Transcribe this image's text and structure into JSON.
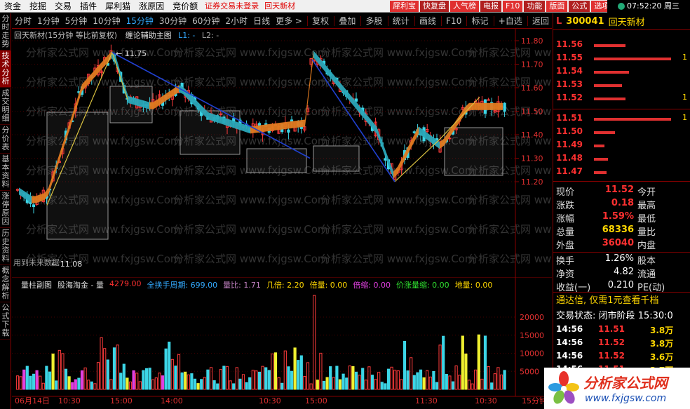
{
  "menu": {
    "items": [
      "资金",
      "挖掘",
      "交易",
      "插件",
      "犀利猫",
      "涨原因",
      "竞价额"
    ],
    "warn1": "证券交易未登录",
    "warn2": "回天新材",
    "right_buttons": [
      "犀利宝",
      "快复盘",
      "人气榜",
      "电报",
      "F10",
      "功能",
      "版面",
      "公式",
      "选项"
    ],
    "clock": "07:52:20 周三"
  },
  "left_tabs": [
    {
      "label": "分时走势",
      "active": false
    },
    {
      "label": "技术分析",
      "active": true
    },
    {
      "label": "成交明细",
      "active": false
    },
    {
      "label": "分价表",
      "active": false
    },
    {
      "label": "基本资料",
      "active": false
    },
    {
      "label": "涨停原因",
      "active": false
    },
    {
      "label": "历史资料",
      "active": false
    },
    {
      "label": "概念解析",
      "active": false
    },
    {
      "label": "公式下载",
      "active": false
    }
  ],
  "period_tabs": [
    {
      "label": "分时",
      "active": false
    },
    {
      "label": "1分钟",
      "active": false
    },
    {
      "label": "5分钟",
      "active": false
    },
    {
      "label": "10分钟",
      "active": false
    },
    {
      "label": "15分钟",
      "active": true
    },
    {
      "label": "30分钟",
      "active": false
    },
    {
      "label": "60分钟",
      "active": false
    },
    {
      "label": "2小时",
      "active": false
    },
    {
      "label": "日线",
      "active": false
    },
    {
      "label": "更多 >",
      "active": false
    }
  ],
  "tool_tabs": [
    "复权",
    "叠加",
    "多股",
    "统计",
    "画线",
    "F10",
    "标记",
    "+自选",
    "返回"
  ],
  "chart_title": {
    "name": "回天新材(15分钟 等比前复权)",
    "indicator": "缠论辅助主图",
    "l1": "L1: -",
    "l2": "L2: -"
  },
  "annotations": {
    "high_label": "11.75",
    "low_label": "11.08",
    "future_label": "用到未来数据"
  },
  "watermark": "分析家公式网 www.fxjgsw.Com",
  "price_axis": [
    "11.80",
    "11.70",
    "11.60",
    "11.50",
    "11.40",
    "11.30",
    "11.20"
  ],
  "vol_axis": [
    "20000",
    "15000",
    "10000",
    "5000"
  ],
  "time_axis": [
    "06月14日",
    "10:30",
    "15:00",
    "14:00",
    "10:30",
    "15:00",
    "11:30",
    "10:30",
    "15分钟"
  ],
  "vol_header": {
    "title": "量柱副图",
    "sub": "股海淘金 - 量",
    "vol": "4279.00",
    "cycle": "全换手周期: 699.00",
    "liangbi": "量比: 1.71",
    "jibei": "几倍: 2.20",
    "beiliang": "倍量: 0.00",
    "beisuo": "倍缩: 0.00",
    "jiazhang": "价涨量缩: 0.00",
    "diliang": "地量: 0.00"
  },
  "quote": {
    "market": "L",
    "code": "300041",
    "name": "回天新材",
    "asks": [
      {
        "price": "11.56",
        "vol": ""
      },
      {
        "price": "11.55",
        "vol": "1"
      },
      {
        "price": "11.54",
        "vol": ""
      },
      {
        "price": "11.53",
        "vol": ""
      },
      {
        "price": "11.52",
        "vol": "1"
      }
    ],
    "bids": [
      {
        "price": "11.51",
        "vol": "1"
      },
      {
        "price": "11.50",
        "vol": ""
      },
      {
        "price": "11.49",
        "vol": ""
      },
      {
        "price": "11.48",
        "vol": ""
      },
      {
        "price": "11.47",
        "vol": ""
      }
    ],
    "stats": [
      {
        "label": "现价",
        "value": "11.52",
        "label2": "今开",
        "color": "r"
      },
      {
        "label": "涨跌",
        "value": "0.18",
        "label2": "最高",
        "color": "r"
      },
      {
        "label": "涨幅",
        "value": "1.59%",
        "label2": "最低",
        "color": "r"
      },
      {
        "label": "总量",
        "value": "68336",
        "label2": "量比",
        "color": "y"
      },
      {
        "label": "外盘",
        "value": "36040",
        "label2": "内盘",
        "color": "r"
      }
    ],
    "stats2": [
      {
        "label": "换手",
        "value": "1.26%",
        "label2": "股本"
      },
      {
        "label": "净资",
        "value": "4.82",
        "label2": "流通"
      },
      {
        "label": "收益(一)",
        "value": "0.210",
        "label2": "PE(动)"
      }
    ],
    "ad": "通达信, 仅需1元查看千档",
    "trade_state_label": "交易状态:",
    "trade_state": "闭市阶段",
    "trade_time": "15:30:0",
    "ticks": [
      {
        "time": "14:56",
        "price": "11.51",
        "vol": "3.8万"
      },
      {
        "time": "14:56",
        "price": "11.52",
        "vol": "3.8万"
      },
      {
        "time": "14:56",
        "price": "11.52",
        "vol": "3.6万"
      },
      {
        "time": "14:56",
        "price": "11.51",
        "vol": "3.7万"
      }
    ]
  },
  "logo": {
    "title": "分析家公式网",
    "url": "www.fxjgsw.com"
  }
}
